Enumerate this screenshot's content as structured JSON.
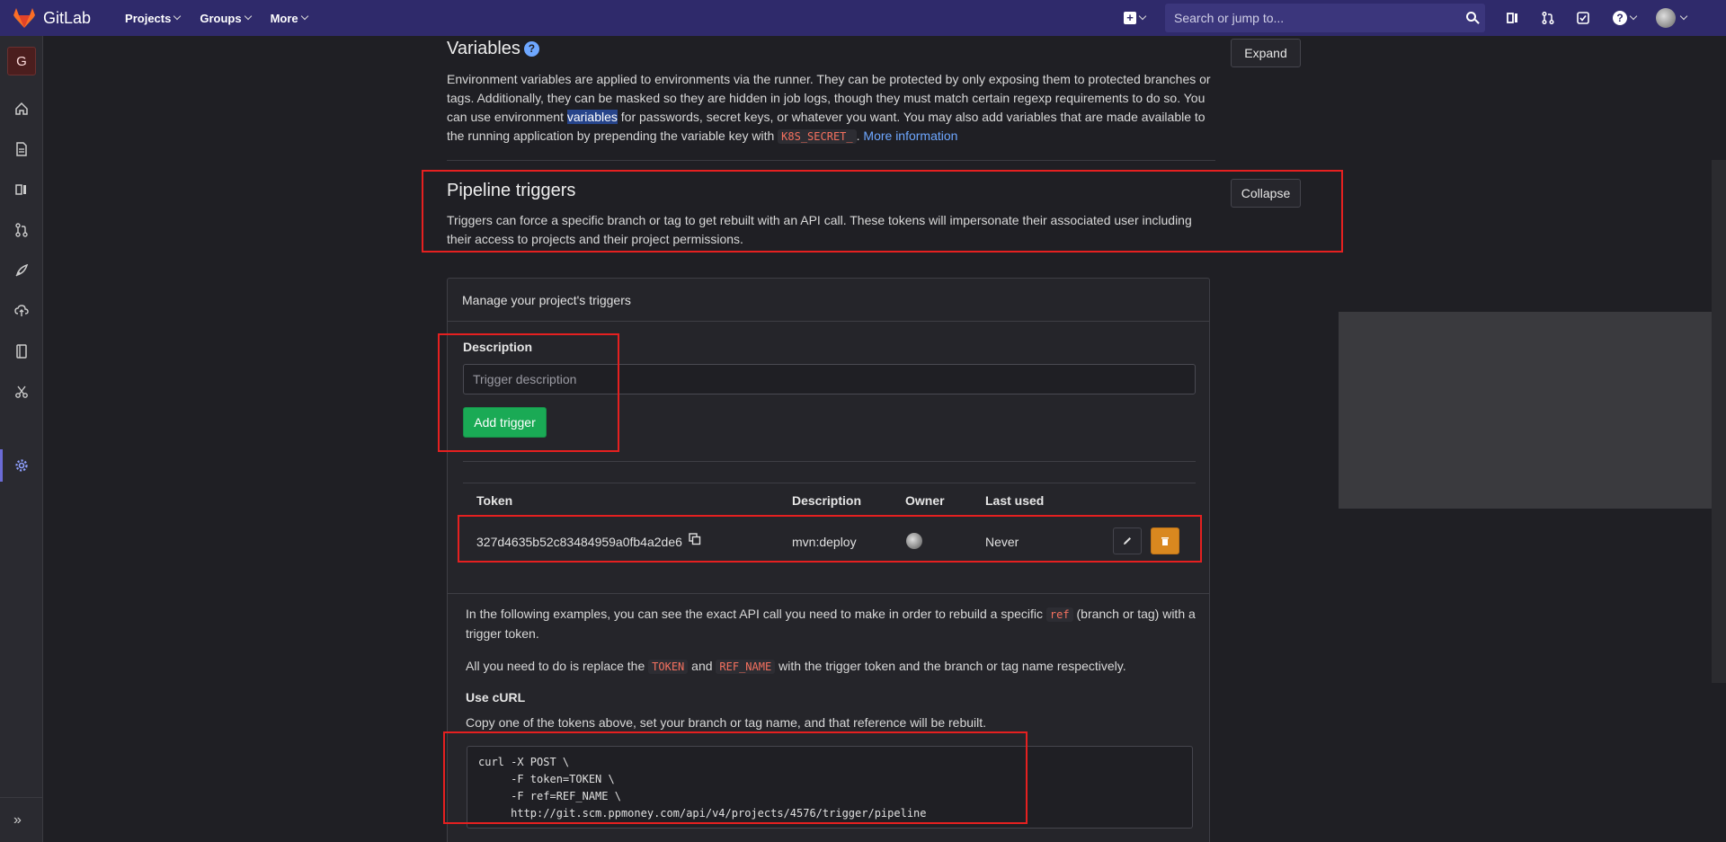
{
  "navbar": {
    "brand": "GitLab",
    "menu": [
      "Projects",
      "Groups",
      "More"
    ],
    "search_placeholder": "Search or jump to...",
    "icons": [
      "plus-square-icon",
      "issues-icon",
      "merge-requests-icon",
      "todos-icon",
      "help-icon",
      "user-avatar"
    ]
  },
  "sidebar": {
    "project_initial": "G",
    "icons": [
      "home-icon",
      "repository-icon",
      "issues-icon",
      "merge-requests-icon",
      "ci-cd-icon",
      "operations-icon",
      "wiki-icon",
      "snippets-icon",
      "settings-icon"
    ],
    "active": "settings-icon",
    "collapse_icon": "double-chevron-right-icon"
  },
  "variables_section": {
    "title": "Variables",
    "button": "Expand",
    "text_1": "Environment variables are applied to environments via the runner. They can be protected by only exposing them to protected branches or tags. Additionally, they can be masked so they are hidden in job logs, though they must match certain regexp requirements to do so. You can use environment ",
    "highlight": "variables",
    "text_2": " for passwords, secret keys, or whatever you want. You may also add variables that are made available to the running application by prepending the variable key with ",
    "code": "K8S_SECRET_",
    "text_3": ". ",
    "link": "More information"
  },
  "triggers_section": {
    "title": "Pipeline triggers",
    "button": "Collapse",
    "text": "Triggers can force a specific branch or tag to get rebuilt with an API call. These tokens will impersonate their associated user including their access to projects and their project permissions."
  },
  "card": {
    "header": "Manage your project's triggers",
    "form_label": "Description",
    "input_placeholder": "Trigger description",
    "add_button": "Add trigger",
    "table": {
      "headers": [
        "Token",
        "Description",
        "Owner",
        "Last used"
      ],
      "rows": [
        {
          "token": "327d4635b52c83484959a0fb4a2de6",
          "description": "mvn:deploy",
          "owner": "avatar",
          "last_used": "Never"
        }
      ]
    },
    "examples_intro_1": "In the following examples, you can see the exact API call you need to make in order to rebuild a specific ",
    "examples_code_ref": "ref",
    "examples_intro_2": " (branch or tag) with a trigger token.",
    "replace_1": "All you need to do is replace the ",
    "replace_code_token": "TOKEN",
    "replace_2": " and ",
    "replace_code_ref": "REF_NAME",
    "replace_3": " with the trigger token and the branch or tag name respectively.",
    "curl_heading": "Use cURL",
    "curl_text": "Copy one of the tokens above, set your branch or tag name, and that reference will be rebuilt.",
    "curl_code": "curl -X POST \\\n     -F token=TOKEN \\\n     -F ref=REF_NAME \\\n     http://git.scm.ppmoney.com/api/v4/projects/4576/trigger/pipeline"
  },
  "colors": {
    "navbar": "#2f2a6b",
    "annotation": "#e52020",
    "add_button": "#1aaa55",
    "delete_button": "#d9881f",
    "link": "#6ea7ff"
  }
}
